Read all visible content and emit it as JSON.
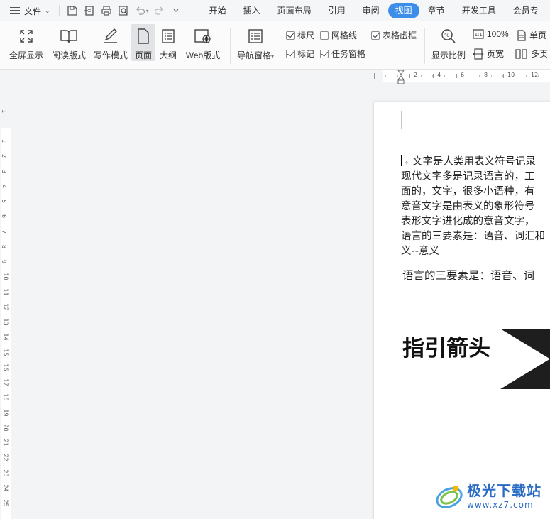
{
  "menubar": {
    "file_label": "文件",
    "tabs": [
      {
        "label": "开始",
        "active": false
      },
      {
        "label": "插入",
        "active": false
      },
      {
        "label": "页面布局",
        "active": false
      },
      {
        "label": "引用",
        "active": false
      },
      {
        "label": "审阅",
        "active": false
      },
      {
        "label": "视图",
        "active": true
      },
      {
        "label": "章节",
        "active": false
      },
      {
        "label": "开发工具",
        "active": false
      },
      {
        "label": "会员专",
        "active": false
      }
    ]
  },
  "ribbon": {
    "fullscreen": "全屏显示",
    "reading": "阅读版式",
    "writing": "写作模式",
    "page": "页面",
    "outline": "大纲",
    "web": "Web版式",
    "nav_pane": "导航窗格",
    "checkboxes": {
      "ruler": {
        "label": "标尺",
        "checked": true
      },
      "gridlines": {
        "label": "网格线",
        "checked": false
      },
      "table_gridlines": {
        "label": "表格虚框",
        "checked": true
      },
      "marks": {
        "label": "标记",
        "checked": true
      },
      "task_pane": {
        "label": "任务窗格",
        "checked": true
      }
    },
    "zoom": "显示比例",
    "zoom_100": "100%",
    "page_width": "页宽",
    "single_page": "单页",
    "multi_page": "多页"
  },
  "hruler_numbers": [
    "2",
    "4",
    "6",
    "8",
    "10",
    "12"
  ],
  "vruler_numbers": [
    "1",
    "1",
    "2",
    "3",
    "4",
    "5",
    "6",
    "7",
    "8",
    "9",
    "10",
    "11",
    "12",
    "13",
    "14",
    "15",
    "16",
    "17",
    "18",
    "19",
    "20",
    "21",
    "22",
    "23",
    "24",
    "25"
  ],
  "document": {
    "lines": [
      "文字是人类用表义符号记录",
      "现代文字多是记录语言的，工",
      "面的，文字，很多小语种，有",
      "意音文字是由表义的象形符号",
      "表形文字进化成的意音文字，",
      "语言的三要素是：语音、词汇和",
      "义--意义"
    ],
    "serif_line": "语言的三要素是：语音、词",
    "heading": "指引箭头"
  },
  "watermark": {
    "title": "极光下载站",
    "url": "www.xz7.com"
  },
  "colors": {
    "accent": "#3d8eea",
    "arrow": "#1e1e1e",
    "watermark": "#2b6cc4"
  }
}
